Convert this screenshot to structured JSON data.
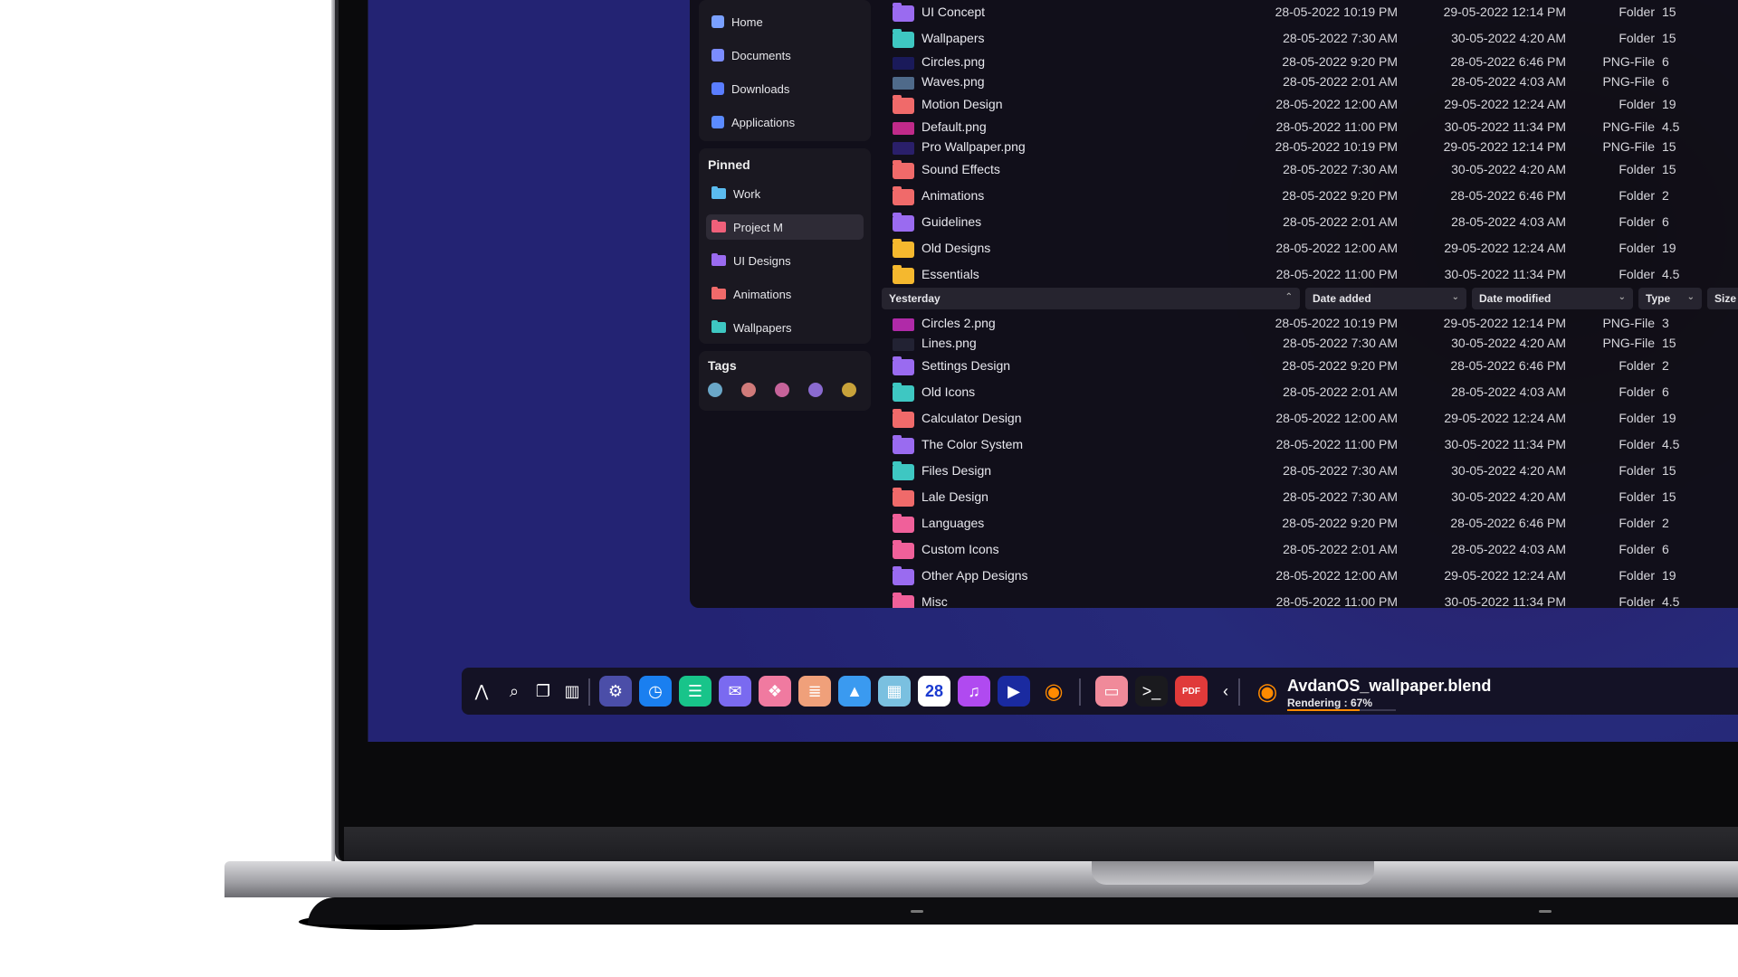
{
  "sidebar": {
    "places": [
      {
        "label": "Home",
        "icon": "home-icon",
        "color": "#7aa0ff"
      },
      {
        "label": "Documents",
        "icon": "document-icon",
        "color": "#7b8cff"
      },
      {
        "label": "Downloads",
        "icon": "download-icon",
        "color": "#5a7dff"
      },
      {
        "label": "Applications",
        "icon": "grid-icon",
        "color": "#5b8bff"
      }
    ],
    "pinned_title": "Pinned",
    "pinned": [
      {
        "label": "Work",
        "color": "#5bbcf0",
        "active": false
      },
      {
        "label": "Project M",
        "color": "#f0607a",
        "active": true
      },
      {
        "label": "UI Designs",
        "color": "#9a6bf0",
        "active": false
      },
      {
        "label": "Animations",
        "color": "#f06a6a",
        "active": false
      },
      {
        "label": "Wallpapers",
        "color": "#3ec7c2",
        "active": false
      }
    ],
    "tags_title": "Tags",
    "tags": [
      "#6aa7c8",
      "#d07a7a",
      "#c6639a",
      "#8a6ad0",
      "#c8a23a"
    ]
  },
  "files_top": [
    {
      "name": "UI Concept",
      "kind": "folder",
      "color": "#9a6bf0",
      "added": "28-05-2022 10:19 PM",
      "modified": "29-05-2022 12:14 PM",
      "type": "Folder",
      "size": "15"
    },
    {
      "name": "Wallpapers",
      "kind": "folder",
      "color": "#3ec7c2",
      "added": "28-05-2022 7:30 AM",
      "modified": "30-05-2022 4:20 AM",
      "type": "Folder",
      "size": "15"
    },
    {
      "name": "Circles.png",
      "kind": "image",
      "color": "#1a1a5a",
      "added": "28-05-2022 9:20 PM",
      "modified": "28-05-2022 6:46 PM",
      "type": "PNG-File",
      "size": "6"
    },
    {
      "name": "Waves.png",
      "kind": "image",
      "color": "#4f6a8a",
      "added": "28-05-2022 2:01 AM",
      "modified": "28-05-2022 4:03 AM",
      "type": "PNG-File",
      "size": "6"
    },
    {
      "name": "Motion Design",
      "kind": "folder",
      "color": "#f06a6a",
      "added": "28-05-2022 12:00 AM",
      "modified": "29-05-2022 12:24 AM",
      "type": "Folder",
      "size": "19"
    },
    {
      "name": "Default.png",
      "kind": "image",
      "color": "#c02a8a",
      "added": "28-05-2022 11:00 PM",
      "modified": "30-05-2022 11:34 PM",
      "type": "PNG-File",
      "size": "4.5"
    },
    {
      "name": "Pro Wallpaper.png",
      "kind": "image",
      "color": "#2a1f6a",
      "added": "28-05-2022 10:19 PM",
      "modified": "29-05-2022 12:14 PM",
      "type": "PNG-File",
      "size": "15"
    },
    {
      "name": "Sound Effects",
      "kind": "folder",
      "color": "#f06a6a",
      "added": "28-05-2022 7:30 AM",
      "modified": "30-05-2022 4:20 AM",
      "type": "Folder",
      "size": "15"
    },
    {
      "name": "Animations",
      "kind": "folder",
      "color": "#f06a6a",
      "added": "28-05-2022 9:20 PM",
      "modified": "28-05-2022 6:46 PM",
      "type": "Folder",
      "size": "2"
    },
    {
      "name": "Guidelines",
      "kind": "folder",
      "color": "#9a6bf0",
      "added": "28-05-2022 2:01 AM",
      "modified": "28-05-2022 4:03 AM",
      "type": "Folder",
      "size": "6"
    },
    {
      "name": "Old Designs",
      "kind": "folder",
      "color": "#f5b82e",
      "added": "28-05-2022 12:00 AM",
      "modified": "29-05-2022 12:24 AM",
      "type": "Folder",
      "size": "19"
    },
    {
      "name": "Essentials",
      "kind": "folder",
      "color": "#f5b82e",
      "added": "28-05-2022 11:00 PM",
      "modified": "30-05-2022 11:34 PM",
      "type": "Folder",
      "size": "4.5"
    }
  ],
  "group_header": {
    "name": "Yesterday",
    "date_added": "Date added",
    "date_modified": "Date modified",
    "type": "Type",
    "size": "Size"
  },
  "files_yesterday": [
    {
      "name": "Circles 2.png",
      "kind": "image",
      "color": "#b02aa8",
      "added": "28-05-2022 10:19 PM",
      "modified": "29-05-2022 12:14 PM",
      "type": "PNG-File",
      "size": "3"
    },
    {
      "name": "Lines.png",
      "kind": "image",
      "color": "#222233",
      "added": "28-05-2022 7:30 AM",
      "modified": "30-05-2022 4:20 AM",
      "type": "PNG-File",
      "size": "15"
    },
    {
      "name": "Settings Design",
      "kind": "folder",
      "color": "#9a6bf0",
      "added": "28-05-2022 9:20 PM",
      "modified": "28-05-2022 6:46 PM",
      "type": "Folder",
      "size": "2"
    },
    {
      "name": "Old Icons",
      "kind": "folder",
      "color": "#3ec7c2",
      "added": "28-05-2022 2:01 AM",
      "modified": "28-05-2022 4:03 AM",
      "type": "Folder",
      "size": "6"
    },
    {
      "name": "Calculator Design",
      "kind": "folder",
      "color": "#f06a6a",
      "added": "28-05-2022 12:00 AM",
      "modified": "29-05-2022 12:24 AM",
      "type": "Folder",
      "size": "19"
    },
    {
      "name": "The Color System",
      "kind": "folder",
      "color": "#9a6bf0",
      "added": "28-05-2022 11:00 PM",
      "modified": "30-05-2022 11:34 PM",
      "type": "Folder",
      "size": "4.5"
    },
    {
      "name": "Files Design",
      "kind": "folder",
      "color": "#3ec7c2",
      "added": "28-05-2022 7:30 AM",
      "modified": "30-05-2022 4:20 AM",
      "type": "Folder",
      "size": "15"
    },
    {
      "name": "Lale Design",
      "kind": "folder",
      "color": "#f06a6a",
      "added": "28-05-2022 7:30 AM",
      "modified": "30-05-2022 4:20 AM",
      "type": "Folder",
      "size": "15"
    },
    {
      "name": "Languages",
      "kind": "folder",
      "color": "#f0609a",
      "added": "28-05-2022 9:20 PM",
      "modified": "28-05-2022 6:46 PM",
      "type": "Folder",
      "size": "2"
    },
    {
      "name": "Custom Icons",
      "kind": "folder",
      "color": "#f0609a",
      "added": "28-05-2022 2:01 AM",
      "modified": "28-05-2022 4:03 AM",
      "type": "Folder",
      "size": "6"
    },
    {
      "name": "Other App Designs",
      "kind": "folder",
      "color": "#9a6bf0",
      "added": "28-05-2022 12:00 AM",
      "modified": "29-05-2022 12:24 AM",
      "type": "Folder",
      "size": "19"
    },
    {
      "name": "Misc",
      "kind": "folder",
      "color": "#f0609a",
      "added": "28-05-2022 11:00 PM",
      "modified": "30-05-2022 11:34 PM",
      "type": "Folder",
      "size": "4.5"
    }
  ],
  "taskbar": {
    "items": [
      {
        "name": "launcher-icon",
        "glyph": "⋀",
        "bg": "transparent"
      },
      {
        "name": "search-icon",
        "glyph": "⌕",
        "bg": "transparent"
      },
      {
        "name": "windows-icon",
        "glyph": "❐",
        "bg": "transparent"
      },
      {
        "name": "layout-icon",
        "glyph": "▥",
        "bg": "transparent"
      },
      {
        "name": "settings-app-icon",
        "glyph": "⚙",
        "bg": "#4b4ea8"
      },
      {
        "name": "clock-app-icon",
        "glyph": "◷",
        "bg": "#1a7ff0"
      },
      {
        "name": "messages-app-icon",
        "glyph": "☰",
        "bg": "#18c48a"
      },
      {
        "name": "mail-app-icon",
        "glyph": "✉",
        "bg": "#7a6af0"
      },
      {
        "name": "photos-app-icon",
        "glyph": "❖",
        "bg": "#f07aa0"
      },
      {
        "name": "notes-app-icon",
        "glyph": "≣",
        "bg": "#f0a07a"
      },
      {
        "name": "gallery-app-icon",
        "glyph": "▲",
        "bg": "#3a9af0"
      },
      {
        "name": "calculator-app-icon",
        "glyph": "▦",
        "bg": "#7ac0e0"
      },
      {
        "name": "calendar-app-icon",
        "glyph": "28",
        "bg": "#ffffff"
      },
      {
        "name": "music-app-icon",
        "glyph": "♫",
        "bg": "#b04af0"
      },
      {
        "name": "video-player-app-icon",
        "glyph": "▶",
        "bg": "#1a2aa0"
      },
      {
        "name": "blender-app-icon",
        "glyph": "◉",
        "bg": "transparent"
      },
      {
        "name": "files-app-icon",
        "glyph": "▭",
        "bg": "#f08a9a"
      },
      {
        "name": "terminal-app-icon",
        "glyph": ">_",
        "bg": "#1a1a1e"
      },
      {
        "name": "pdf-app-icon",
        "glyph": "PDF",
        "bg": "#e03a3a"
      },
      {
        "name": "collapse-chevron-icon",
        "glyph": "‹",
        "bg": "transparent"
      }
    ],
    "render": {
      "title": "AvdanOS_wallpaper.blend",
      "status": "Rendering :  67%",
      "progress": 0.67
    }
  }
}
